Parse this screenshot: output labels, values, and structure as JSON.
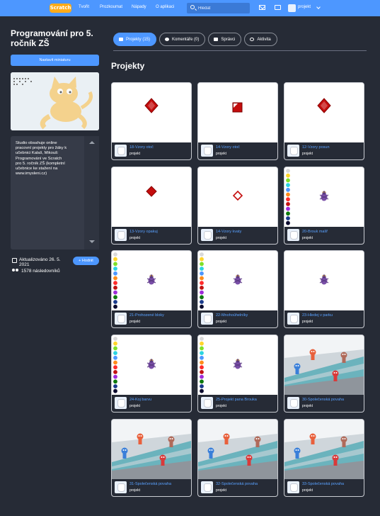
{
  "nav": {
    "logo": "Scratch",
    "links": [
      "Tvořit",
      "Prozkoumat",
      "Nápady",
      "O aplikaci"
    ],
    "search_placeholder": "Hledat",
    "username": "projekt"
  },
  "studio": {
    "title": "Programování pro 5. ročník ZŠ",
    "thumbnail_button": "Nastavit miniaturu",
    "description": "Studio obsahuje online\npracovní projekty pro žáky k\nučebnici Kalaš, Mikouš:\nProgramování ve Scratch\npro 5. ročník ZŠ (kompletní\nučebnice ke stažení na\nwww.imysleni.cz)",
    "updated": "Aktualizováno 26. 5. 2021",
    "followers": "1578 následovníků",
    "follow_button": "+ Hodnit"
  },
  "tabs": [
    {
      "label": "Projekty (15)",
      "icon": "projects-icon",
      "active": true
    },
    {
      "label": "Komentáře (0)",
      "icon": "comments-icon",
      "active": false
    },
    {
      "label": "Správci",
      "icon": "curators-icon",
      "active": false
    },
    {
      "label": "Aktivita",
      "icon": "activity-icon",
      "active": false
    }
  ],
  "section_title": "Projekty",
  "projects": [
    {
      "name": "18-Vzory otoč",
      "author": "projekt",
      "thumb": "diamond"
    },
    {
      "name": "14-Vzory otoč",
      "author": "projekt",
      "thumb": "square"
    },
    {
      "name": "12-Vzory posun",
      "author": "projekt",
      "thumb": "diamond"
    },
    {
      "name": "13-Vzory opakuj",
      "author": "projekt",
      "thumb": "diamond-small"
    },
    {
      "name": "14-Vzory kvaty",
      "author": "projekt",
      "thumb": "diamond-outline"
    },
    {
      "name": "20-Brouk malíř",
      "author": "projekt",
      "thumb": "palette"
    },
    {
      "name": "21-Prohozené bloky",
      "author": "projekt",
      "thumb": "palette"
    },
    {
      "name": "22-Mnohoúhelníky",
      "author": "projekt",
      "thumb": "palette"
    },
    {
      "name": "23-Hledej v parku",
      "author": "projekt",
      "thumb": "bug"
    },
    {
      "name": "24-Koj barvu",
      "author": "projekt",
      "thumb": "palette"
    },
    {
      "name": "25-Projekt pana Brouka",
      "author": "projekt",
      "thumb": "palette"
    },
    {
      "name": "30-Společenská povaha",
      "author": "projekt",
      "thumb": "scene"
    },
    {
      "name": "31-Společenská povaha",
      "author": "projekt",
      "thumb": "scene"
    },
    {
      "name": "32-Společenská povaha",
      "author": "projekt",
      "thumb": "scene"
    },
    {
      "name": "33-Společenská povaha",
      "author": "projekt",
      "thumb": "scene"
    }
  ],
  "palette_colors": [
    "#d9d9d9",
    "#ffd52b",
    "#7ee028",
    "#2bd4e0",
    "#4d97ff",
    "#ff8c1a",
    "#ff2b2b",
    "#c21212",
    "#9e2bd9",
    "#0e7a0e",
    "#1a3b8c",
    "#0b0b2e"
  ],
  "colors": {
    "accent": "#4d97ff",
    "background": "#262b36",
    "link": "#59a1ff"
  }
}
